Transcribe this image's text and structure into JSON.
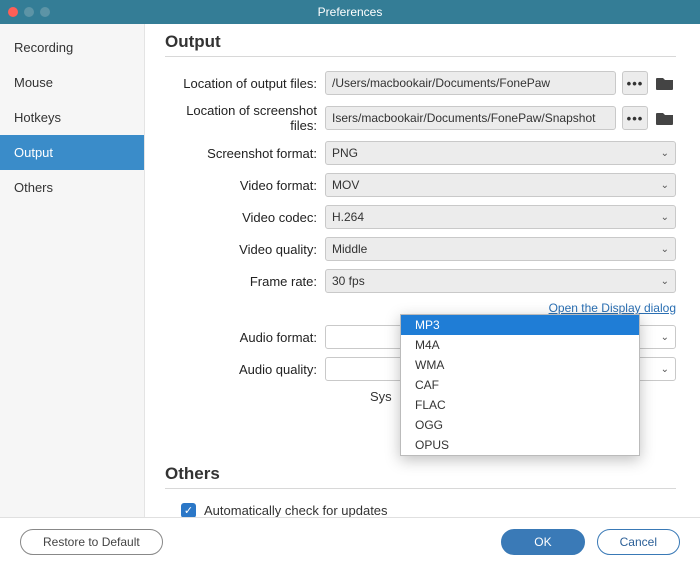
{
  "window": {
    "title": "Preferences"
  },
  "sidebar": {
    "items": [
      {
        "label": "Recording",
        "active": false
      },
      {
        "label": "Mouse",
        "active": false
      },
      {
        "label": "Hotkeys",
        "active": false
      },
      {
        "label": "Output",
        "active": true
      },
      {
        "label": "Others",
        "active": false
      }
    ]
  },
  "section_output": {
    "title": "Output",
    "location_output_label": "Location of output files:",
    "location_output_value": "/Users/macbookair/Documents/FonePaw",
    "location_screenshot_label": "Location of screenshot files:",
    "location_screenshot_value": "Isers/macbookair/Documents/FonePaw/Snapshot",
    "screenshot_format_label": "Screenshot format:",
    "screenshot_format_value": "PNG",
    "video_format_label": "Video format:",
    "video_format_value": "MOV",
    "video_codec_label": "Video codec:",
    "video_codec_value": "H.264",
    "video_quality_label": "Video quality:",
    "video_quality_value": "Middle",
    "frame_rate_label": "Frame rate:",
    "frame_rate_value": "30 fps",
    "display_link": "Open the Display dialog",
    "audio_format_label": "Audio format:",
    "audio_format_options": [
      "MP3",
      "M4A",
      "WMA",
      "CAF",
      "FLAC",
      "OGG",
      "OPUS"
    ],
    "audio_format_selected": "MP3",
    "audio_quality_label": "Audio quality:",
    "sys_label_prefix": "Sys"
  },
  "section_others": {
    "title": "Others",
    "auto_update_label": "Automatically check for updates",
    "auto_update_checked": true
  },
  "footer": {
    "restore": "Restore to Default",
    "ok": "OK",
    "cancel": "Cancel"
  }
}
